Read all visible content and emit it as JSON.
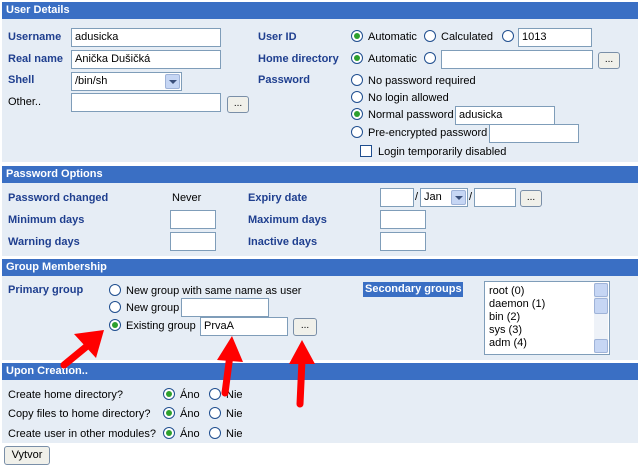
{
  "user_details": {
    "header": "User Details",
    "username_label": "Username",
    "username_value": "adusicka",
    "realname_label": "Real name",
    "realname_value": "Anička Dušičká",
    "shell_label": "Shell",
    "shell_value": "/bin/sh",
    "other_label": "Other..",
    "other_value": "",
    "browse_label": "...",
    "userid_label": "User ID",
    "userid_automatic": "Automatic",
    "userid_calculated": "Calculated",
    "userid_value": "1013",
    "homedir_label": "Home directory",
    "homedir_automatic": "Automatic",
    "homedir_value": "",
    "password_label": "Password",
    "pw_none": "No password required",
    "pw_nologin": "No login allowed",
    "pw_normal": "Normal password",
    "pw_normal_value": "adusicka",
    "pw_preenc": "Pre-encrypted password",
    "pw_preenc_value": "",
    "login_disabled": "Login temporarily disabled"
  },
  "password_options": {
    "header": "Password Options",
    "changed_label": "Password changed",
    "changed_value": "Never",
    "expiry_label": "Expiry date",
    "expiry_day": "",
    "expiry_sep1": "/",
    "expiry_month": "Jan",
    "expiry_sep2": "/",
    "expiry_year": "",
    "min_label": "Minimum days",
    "max_label": "Maximum days",
    "warn_label": "Warning days",
    "inactive_label": "Inactive days"
  },
  "group_membership": {
    "header": "Group Membership",
    "primary_label": "Primary group",
    "opt_same_name": "New group with same name as user",
    "opt_new": "New group",
    "opt_new_value": "",
    "opt_existing": "Existing group",
    "existing_value": "PrvaA",
    "secondary_label": "Secondary groups",
    "secondary_items": [
      "root (0)",
      "daemon (1)",
      "bin (2)",
      "sys (3)",
      "adm (4)"
    ]
  },
  "upon_creation": {
    "header": "Upon Creation..",
    "row1_label": "Create home directory?",
    "row2_label": "Copy files to home directory?",
    "row3_label": "Create user in other modules?",
    "yes": "Áno",
    "no": "Nie"
  },
  "submit_label": "Vytvor",
  "colors": {
    "header_bg": "#3a6fc4",
    "panel_bg": "#e6edf5",
    "label_blue": "#1f3f8f",
    "annotation_arrow": "#ff0000"
  }
}
